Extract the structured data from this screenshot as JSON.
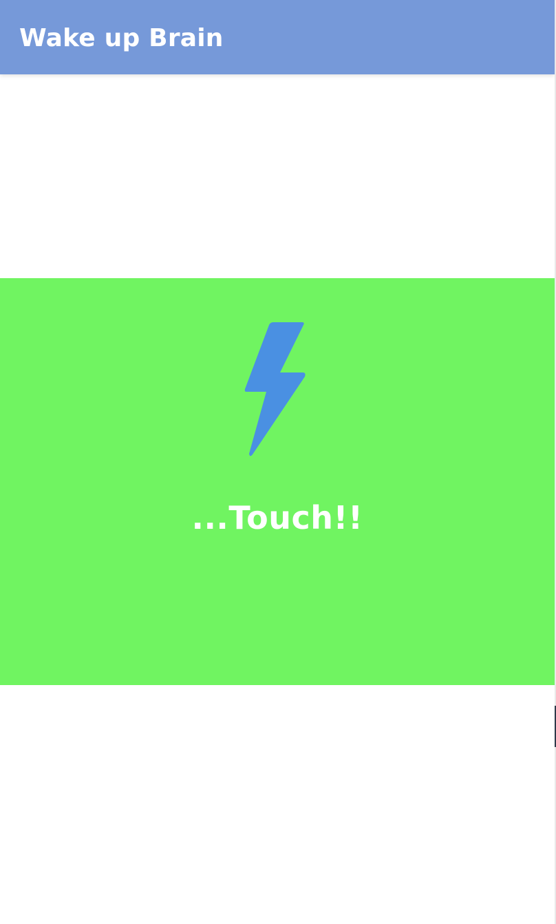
{
  "app_bar": {
    "title": "Wake up Brain"
  },
  "touch_panel": {
    "label": "...Touch!!",
    "icon": "lightning-bolt-icon"
  },
  "colors": {
    "app_bar": "#7699d9",
    "panel": "#70f461",
    "bolt": "#4a90e2",
    "text": "#ffffff"
  }
}
